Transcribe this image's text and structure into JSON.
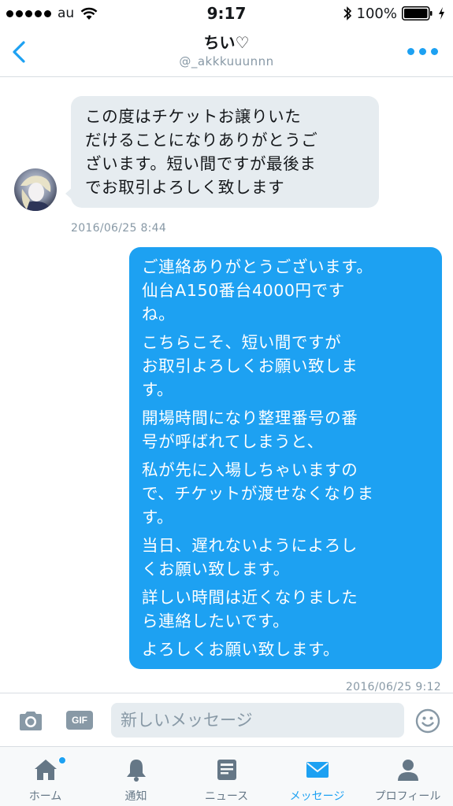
{
  "status_bar": {
    "carrier": "au",
    "time": "9:17",
    "battery_percent": "100%",
    "battery_level": 1.0
  },
  "header": {
    "title": "ちい♡",
    "handle": "@_akkkuuunnn"
  },
  "messages": {
    "incoming": {
      "text": "この度はチケットお譲りいた\nだけることになりありがとうご\nざいます。短い間ですが最後ま\nでお取引よろしく致します",
      "timestamp": "2016/06/25 8:44"
    },
    "outgoing": {
      "paragraphs": [
        "ご連絡ありがとうございます。\n仙台A150番台4000円です\nね。",
        "こちらこそ、短い間ですが\nお取引よろしくお願い致しま\nす。",
        "開場時間になり整理番号の番\n号が呼ばれてしまうと、",
        "私が先に入場しちゃいますの\nで、チケットが渡せなくなりま\nす。",
        "当日、遅れないようによろし\nくお願い致します。",
        "詳しい時間は近くなりました\nら連絡したいです。",
        "よろしくお願い致します。"
      ],
      "timestamp": "2016/06/25 9:12"
    }
  },
  "composer": {
    "gif_label": "GIF",
    "placeholder": "新しいメッセージ"
  },
  "tabs": [
    {
      "label": "ホーム",
      "icon": "home-icon"
    },
    {
      "label": "通知",
      "icon": "bell-icon"
    },
    {
      "label": "ニュース",
      "icon": "news-icon"
    },
    {
      "label": "メッセージ",
      "icon": "envelope-icon",
      "active": true
    },
    {
      "label": "プロフィール",
      "icon": "profile-icon"
    }
  ],
  "colors": {
    "accent": "#1da1f2",
    "bubble_incoming": "#e6ecf0",
    "muted_text": "#8899a6",
    "tab_inactive": "#657786"
  }
}
